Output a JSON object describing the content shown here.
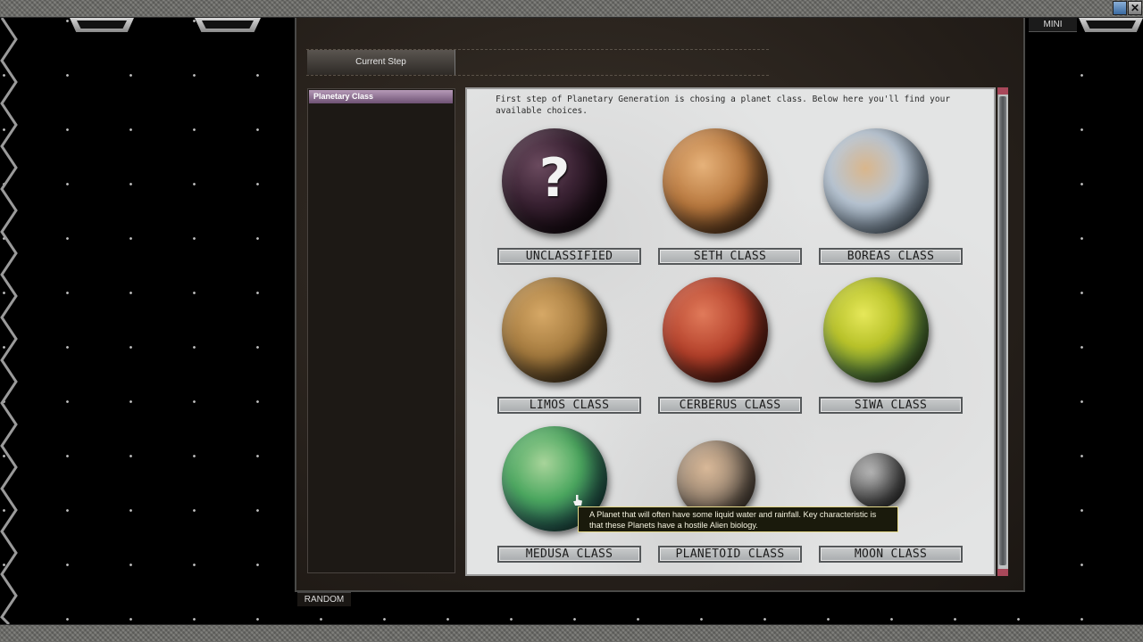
{
  "header": {
    "current_step_label": "Current Step",
    "mini_label": "MINI"
  },
  "window_controls": {
    "minimize_icon": "minimize-icon",
    "close_icon": "close-icon",
    "close_glyph": "✕"
  },
  "sidebar": {
    "items": [
      {
        "label": "Planetary Class",
        "active": true
      }
    ]
  },
  "content": {
    "intro_text": "First step of Planetary Generation is chosing a planet class. Below here you'll find  your available choices.",
    "planets": [
      {
        "label": "UNCLASSIFIED",
        "icon": "question-mark-icon"
      },
      {
        "label": "SETH CLASS"
      },
      {
        "label": "BOREAS CLASS"
      },
      {
        "label": "LIMOS CLASS"
      },
      {
        "label": "CERBERUS CLASS"
      },
      {
        "label": "SIWA CLASS"
      },
      {
        "label": "MEDUSA CLASS"
      },
      {
        "label": "PLANETOID CLASS"
      },
      {
        "label": "MOON CLASS"
      }
    ],
    "question_glyph": "?"
  },
  "tooltip": {
    "text": "A Planet that will often have some liquid water and rainfall. Key characteristic is that these Planets have a hostile Alien biology."
  },
  "footer": {
    "random_label": "RANDOM"
  },
  "colors": {
    "active_item": "#8e6e93",
    "tooltip_border": "#e5d98a",
    "scroll_arrow": "#a8485a"
  }
}
